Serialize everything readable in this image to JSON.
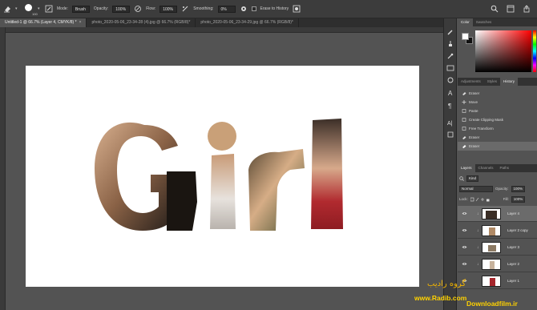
{
  "options_bar": {
    "brush_size": "100",
    "mode_label": "Mode:",
    "mode_value": "Brush",
    "opacity_label": "Opacity:",
    "opacity_value": "100%",
    "flow_label": "Flow:",
    "flow_value": "100%",
    "smoothing_label": "Smoothing:",
    "smoothing_value": "0%",
    "erase_history_label": "Erase to History"
  },
  "tabs": [
    {
      "label": "Untitled-1 @ 66.7% (Layer 4, CMYK/8) *",
      "close": "×",
      "active": true
    },
    {
      "label": "photo_2020-05-06_23-34-28 (4).jpg @ 66.7% (RGB/8)*",
      "close": "",
      "active": false
    },
    {
      "label": "photo_2020-05-06_23-34-29.jpg @ 66.7% (RGB/8)*",
      "close": "",
      "active": false
    }
  ],
  "canvas": {
    "word": "Girl"
  },
  "panels": {
    "color_tabs": [
      "Color",
      "Swatches"
    ],
    "history_tabs": [
      "Adjustments",
      "Styles",
      "History"
    ],
    "history_items": [
      "Eraser",
      "Move",
      "Paste",
      "Create Clipping Mask",
      "Free Transform",
      "Eraser",
      "Eraser"
    ],
    "layers_tabs": [
      "Layers",
      "Channels",
      "Paths"
    ],
    "filter_kind": "Kind",
    "blend_mode": "Normal",
    "opacity_label": "Opacity:",
    "opacity_value": "100%",
    "lock_label": "Lock:",
    "fill_label": "Fill:",
    "fill_value": "100%",
    "layers": [
      {
        "name": "Layer 4",
        "selected": true
      },
      {
        "name": "Layer 2 copy",
        "selected": false
      },
      {
        "name": "Layer 3",
        "selected": false
      },
      {
        "name": "Layer 2",
        "selected": false
      },
      {
        "name": "Layer 1",
        "selected": false
      }
    ]
  },
  "watermark": {
    "persian": "گروه رادیب",
    "url": "www.Radib.com",
    "url2": "Downloadfilm.ir"
  },
  "colors": {
    "accent_yellow": "#ffd200",
    "panel_bg": "#535353",
    "bar_bg": "#3c3c3c"
  }
}
